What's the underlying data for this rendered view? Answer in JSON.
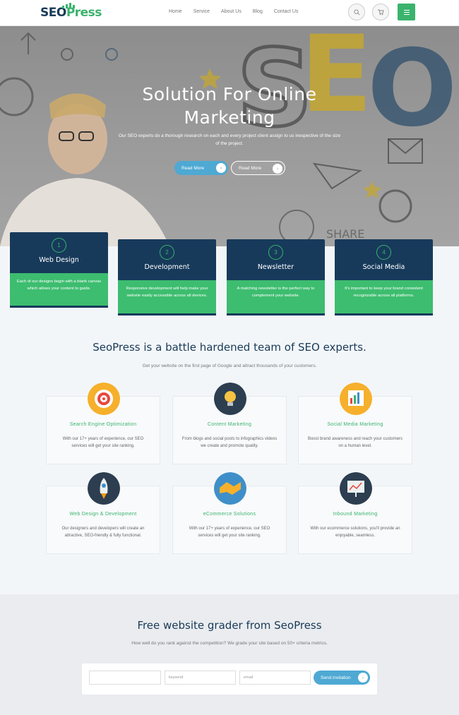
{
  "header": {
    "logo_main": "SEO",
    "logo_accent": "Press",
    "nav": [
      "Home",
      "Service",
      "About Us",
      "Blog",
      "Contact Us"
    ]
  },
  "hero": {
    "title_line1": "Solution For Online",
    "title_line2": "Marketing",
    "subtitle": "Our SEO experts do a thorough research on each and every project client assign to us inespective of the size of the project.",
    "btn_primary": "Read More",
    "btn_secondary": "Read More"
  },
  "features": [
    {
      "num": "1",
      "title": "Web Design",
      "text": "Each of our designs begin with a blank canvas which allows your content to guide."
    },
    {
      "num": "2",
      "title": "Development",
      "text": "Responsive development will help make your website easily accessible across all devices."
    },
    {
      "num": "3",
      "title": "Newsletter",
      "text": "A matching newsletter is the perfect way to complement your website."
    },
    {
      "num": "4",
      "title": "Social Media",
      "text": "It's important to keep your brand consistent recognizable across all platforms."
    }
  ],
  "about": {
    "title": "SeoPress is a battle hardened team of SEO experts.",
    "subtitle": "Get your website on the first page of Google and attract thousands of your customers."
  },
  "services": [
    {
      "title": "Search Engine Optimization",
      "text": "With our 17+ years of experience, our SEO services will get your site ranking.",
      "icon": "target-icon",
      "color": "#f6b02b"
    },
    {
      "title": "Content Marketing",
      "text": "From blogs and social posts to infographics videos we create and promote quality.",
      "icon": "lightbulb-icon",
      "color": "#2c3e50"
    },
    {
      "title": "Social Media Marketing",
      "text": "Boost brand awareness and reach your customers on a human level.",
      "icon": "presentation-icon",
      "color": "#f6b02b"
    },
    {
      "title": "Web Design & Development",
      "text": "Our designers and developers will create an attractive, SEO-friendly & fully functional.",
      "icon": "rocket-icon",
      "color": "#2c3e50"
    },
    {
      "title": "eCommerce Solutions",
      "text": "With our 17+ years of experience, our SEO services will get your site ranking.",
      "icon": "handshake-icon",
      "color": "#3e8fc9"
    },
    {
      "title": "Inbound Marketing",
      "text": "With our ecommerce solutions, you'll provide an enjoyable, seamless.",
      "icon": "board-icon",
      "color": "#2c3e50"
    }
  ],
  "grader": {
    "title": "Free website grader from SeoPress",
    "subtitle": "How well do you rank against the competition? We grade your site based on 50+ criteria metrics.",
    "field1_placeholder": "",
    "field2_placeholder": "keyword",
    "field3_placeholder": "email",
    "button": "Send invitation"
  },
  "colors": {
    "navy": "#173a5b",
    "green": "#3dbd6f",
    "blue": "#4ea9d3"
  }
}
